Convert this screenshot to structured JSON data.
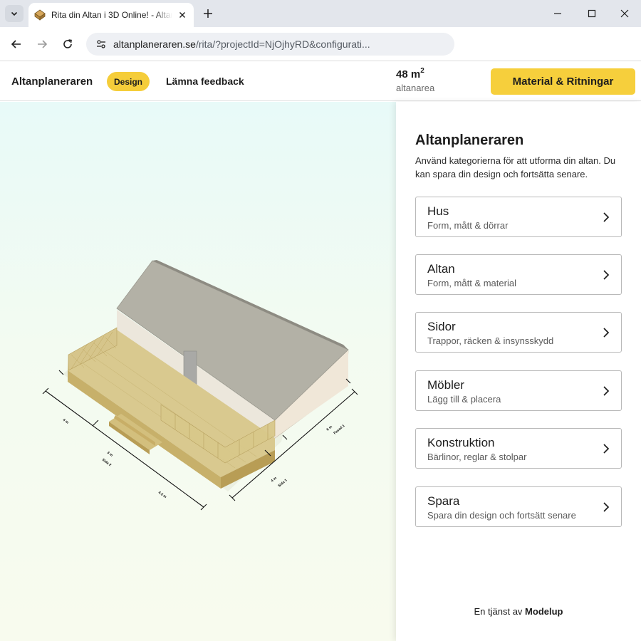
{
  "browser": {
    "tab_title": "Rita din Altan i 3D Online! - Altanplaneraren",
    "url_host": "altanplaneraren.se",
    "url_path": "/rita/?projectId=NjOjhyRD&configurati..."
  },
  "header": {
    "brand": "Altanplaneraren",
    "mode_badge": "Design",
    "feedback_link": "Lämna feedback",
    "area_value": "48 m",
    "area_unit_sup": "2",
    "area_label": "altanarea",
    "cta_label": "Material & Ritningar"
  },
  "viewport": {
    "dimension_labels": [
      "4 m",
      "3 m",
      "Sida 2",
      "4.5 m",
      "4 m",
      "Sida 1",
      "6 m",
      "Fasad 1"
    ]
  },
  "panel": {
    "title": "Altanplaneraren",
    "description": "Använd kategorierna för att utforma din altan. Du kan spara din design och fortsätta senare.",
    "cards": [
      {
        "title": "Hus",
        "subtitle": "Form, mått & dörrar"
      },
      {
        "title": "Altan",
        "subtitle": "Form, mått & material"
      },
      {
        "title": "Sidor",
        "subtitle": "Trappor, räcken & insynsskydd"
      },
      {
        "title": "Möbler",
        "subtitle": "Lägg till & placera"
      },
      {
        "title": "Konstruktion",
        "subtitle": "Bärlinor, reglar & stolpar"
      },
      {
        "title": "Spara",
        "subtitle": "Spara din design och fortsätt senare"
      }
    ],
    "footer_prefix": "En tjänst av ",
    "footer_brand": "Modelup"
  },
  "colors": {
    "accent_yellow": "#f6cf3c",
    "deck_wood": "#d9c98f",
    "roof_grey": "#b3b1a6",
    "wall_cream": "#ece3d3"
  }
}
